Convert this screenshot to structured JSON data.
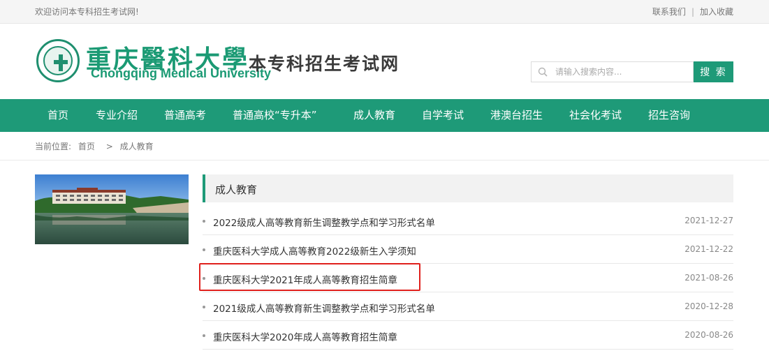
{
  "topbar": {
    "welcome": "欢迎访问本专科招生考试网!",
    "contact": "联系我们",
    "separator": "|",
    "bookmark": "加入收藏"
  },
  "header": {
    "school_name_cn": "重庆醫科大學",
    "school_name_en": "Chongqing Medical University",
    "site_name": "本专科招生考试网",
    "seal_icon": "university-seal-icon"
  },
  "search": {
    "placeholder": "请输入搜索内容...",
    "button_label": "搜 索"
  },
  "nav": {
    "items": [
      {
        "label": "首页"
      },
      {
        "label": "专业介绍"
      },
      {
        "label": "普通高考"
      },
      {
        "label": "普通高校“专升本”"
      },
      {
        "label": "成人教育"
      },
      {
        "label": "自学考试"
      },
      {
        "label": "港澳台招生"
      },
      {
        "label": "社会化考试"
      },
      {
        "label": "招生咨询"
      }
    ]
  },
  "breadcrumb": {
    "prefix": "当前位置:",
    "home": "首页",
    "separator": ">",
    "current": "成人教育"
  },
  "section": {
    "title": "成人教育"
  },
  "news": [
    {
      "title": "2022级成人高等教育新生调整教学点和学习形式名单",
      "date": "2021-12-27"
    },
    {
      "title": "重庆医科大学成人高等教育2022级新生入学须知",
      "date": "2021-12-22"
    },
    {
      "title": "重庆医科大学2021年成人高等教育招生简章",
      "date": "2021-08-26"
    },
    {
      "title": "2021级成人高等教育新生调整教学点和学习形式名单",
      "date": "2020-12-28"
    },
    {
      "title": "重庆医科大学2020年成人高等教育招生简章",
      "date": "2020-08-26"
    }
  ],
  "colors": {
    "brand_green": "#1e9a78",
    "highlight_red": "#e0201c"
  }
}
